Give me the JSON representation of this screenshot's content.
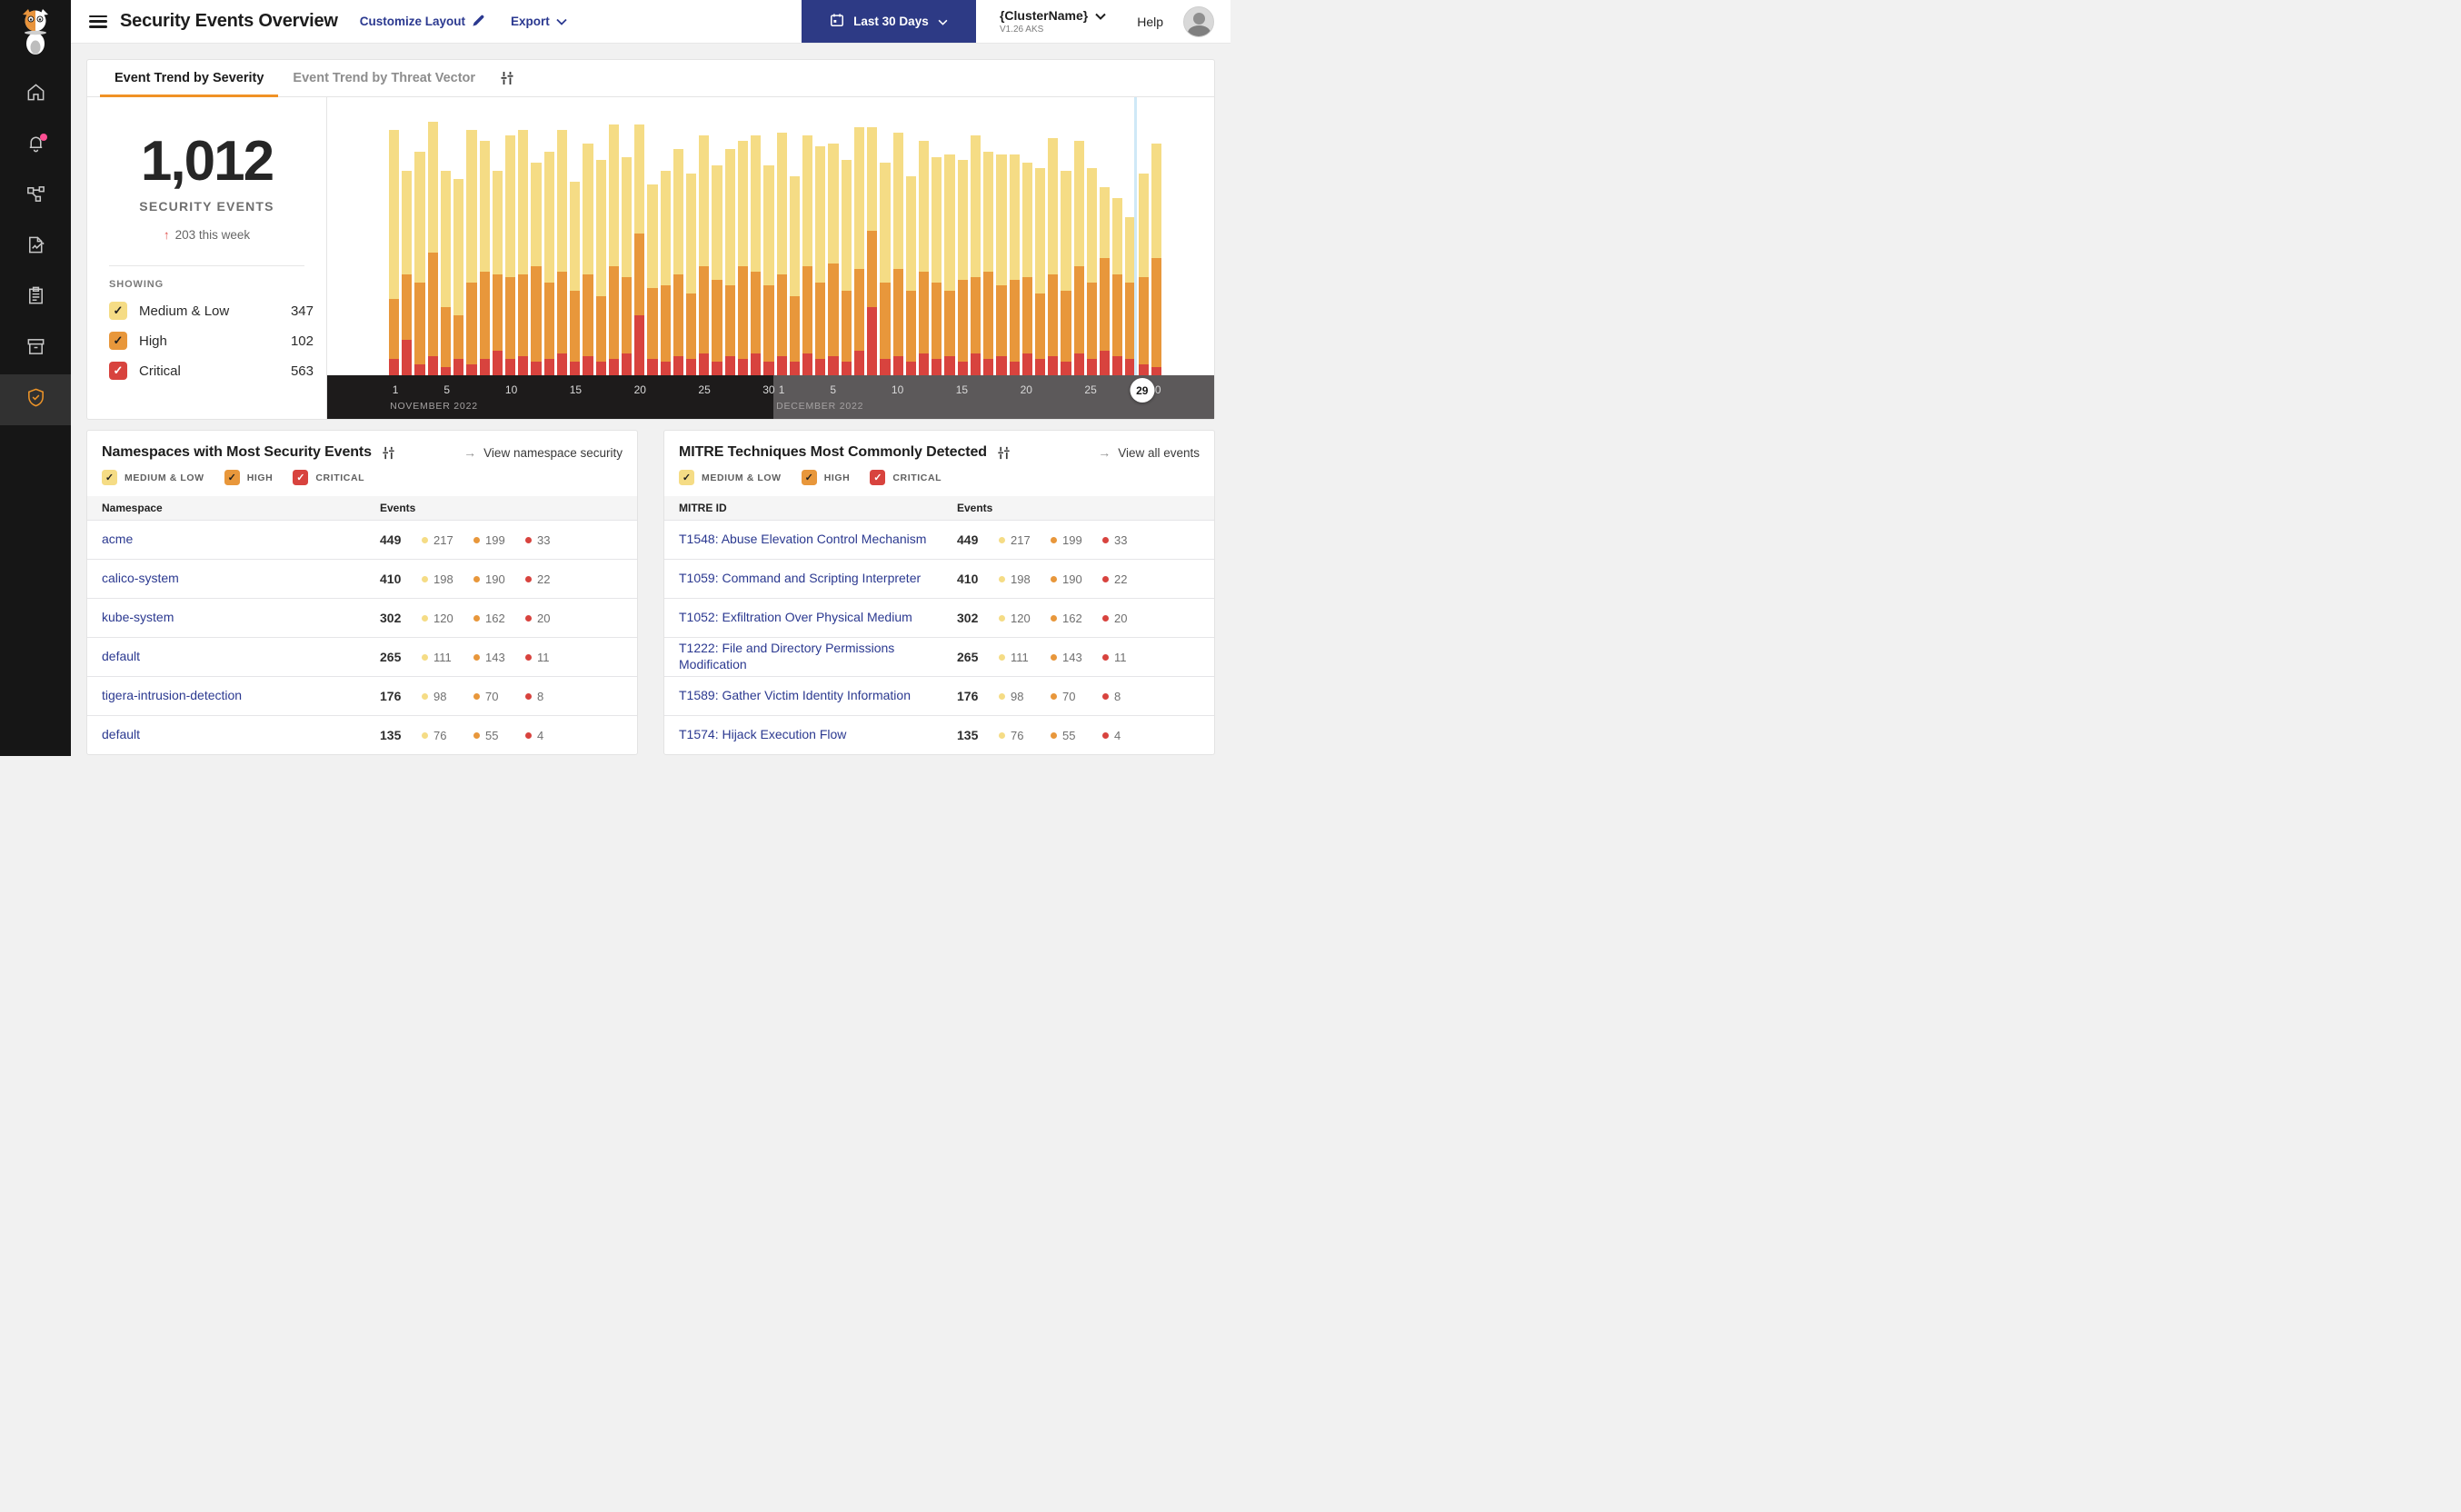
{
  "header": {
    "title": "Security Events Overview",
    "customize_layout": "Customize Layout",
    "export_label": "Export",
    "date_range": "Last 30 Days",
    "cluster_name": "{ClusterName}",
    "cluster_version": "V1.26 AKS",
    "help": "Help"
  },
  "sidebar": {
    "items": [
      "home",
      "notifications",
      "service-graph",
      "policies",
      "compliance-reports",
      "workloads",
      "security-events"
    ],
    "active_item": "security-events",
    "notification_badge": true
  },
  "tabs": {
    "severity": "Event Trend by Severity",
    "threat_vector": "Event Trend by Threat Vector"
  },
  "summary": {
    "total": "1,012",
    "label": "SECURITY EVENTS",
    "delta_arrow": "↑",
    "delta": "203 this week",
    "showing_label": "SHOWING",
    "severities": [
      {
        "label": "Medium & Low",
        "count": "347"
      },
      {
        "label": "High",
        "count": "102"
      },
      {
        "label": "Critical",
        "count": "563"
      }
    ]
  },
  "colors": {
    "medium": "#F5DC85",
    "high": "#E8973B",
    "critical": "#D8433E",
    "check_dark": "#1f1f1f",
    "check_light": "#ffffff",
    "accent": "#F09225",
    "navy": "#2B3990",
    "highlight_line": "#CFE9F7"
  },
  "chart_data": {
    "type": "bar",
    "stacked": true,
    "title": "Event Trend by Severity",
    "grid": false,
    "note": "no y-axis shown; values are estimated bar-segment heights as percent of plot height",
    "ylim": [
      0,
      100
    ],
    "months": [
      {
        "label": "NOVEMBER 2022",
        "days": 30,
        "ticks": [
          1,
          5,
          10,
          15,
          20,
          25,
          30
        ]
      },
      {
        "label": "DECEMBER 2022",
        "days": 30,
        "ticks": [
          1,
          5,
          10,
          15,
          20,
          25,
          30
        ]
      }
    ],
    "highlighted_day": {
      "month_index": 1,
      "day": 29,
      "marker": "29"
    },
    "series": [
      {
        "name": "Medium & Low",
        "values": [
          62,
          38,
          48,
          48,
          50,
          50,
          56,
          48,
          38,
          52,
          53,
          38,
          48,
          52,
          40,
          48,
          50,
          52,
          44,
          40,
          38,
          42,
          46,
          44,
          48,
          42,
          50,
          46,
          50,
          44,
          52,
          44,
          48,
          50,
          44,
          48,
          52,
          38,
          44,
          50,
          42,
          48,
          46,
          50,
          44,
          52,
          44,
          48,
          46,
          42,
          46,
          50,
          44,
          46,
          42,
          26,
          28,
          24,
          38,
          42
        ]
      },
      {
        "name": "High",
        "values": [
          22,
          24,
          30,
          38,
          22,
          16,
          30,
          32,
          28,
          30,
          30,
          35,
          28,
          30,
          26,
          30,
          24,
          34,
          28,
          30,
          26,
          28,
          30,
          24,
          32,
          30,
          26,
          34,
          30,
          28,
          30,
          24,
          32,
          28,
          34,
          26,
          30,
          28,
          28,
          32,
          26,
          30,
          28,
          24,
          30,
          28,
          32,
          26,
          30,
          28,
          24,
          30,
          26,
          32,
          28,
          34,
          30,
          28,
          32,
          40
        ]
      },
      {
        "name": "Critical",
        "values": [
          6,
          13,
          4,
          7,
          3,
          6,
          4,
          6,
          9,
          6,
          7,
          5,
          6,
          8,
          5,
          7,
          5,
          6,
          8,
          22,
          6,
          5,
          7,
          6,
          8,
          5,
          7,
          6,
          8,
          5,
          7,
          5,
          8,
          6,
          7,
          5,
          9,
          25,
          6,
          7,
          5,
          8,
          6,
          7,
          5,
          8,
          6,
          7,
          5,
          8,
          6,
          7,
          5,
          8,
          6,
          9,
          7,
          6,
          4,
          3
        ]
      }
    ]
  },
  "filters": [
    "MEDIUM & LOW",
    "HIGH",
    "CRITICAL"
  ],
  "namespaces_card": {
    "title": "Namespaces with Most Security Events",
    "link": "View namespace security",
    "columns": [
      "Namespace",
      "Events"
    ],
    "rows": [
      {
        "name": "acme",
        "total": 449,
        "medium": 217,
        "high": 199,
        "critical": 33
      },
      {
        "name": "calico-system",
        "total": 410,
        "medium": 198,
        "high": 190,
        "critical": 22
      },
      {
        "name": "kube-system",
        "total": 302,
        "medium": 120,
        "high": 162,
        "critical": 20
      },
      {
        "name": "default",
        "total": 265,
        "medium": 111,
        "high": 143,
        "critical": 11
      },
      {
        "name": "tigera-intrusion-detection",
        "total": 176,
        "medium": 98,
        "high": 70,
        "critical": 8
      },
      {
        "name": "default",
        "total": 135,
        "medium": 76,
        "high": 55,
        "critical": 4
      }
    ]
  },
  "mitre_card": {
    "title": "MITRE Techniques Most Commonly Detected",
    "link": "View all events",
    "columns": [
      "MITRE ID",
      "Events"
    ],
    "rows": [
      {
        "name": "T1548: Abuse Elevation Control Mechanism",
        "total": 449,
        "medium": 217,
        "high": 199,
        "critical": 33
      },
      {
        "name": "T1059: Command and Scripting Interpreter",
        "total": 410,
        "medium": 198,
        "high": 190,
        "critical": 22
      },
      {
        "name": "T1052: Exfiltration Over Physical Medium",
        "total": 302,
        "medium": 120,
        "high": 162,
        "critical": 20
      },
      {
        "name": "T1222: File and Directory Permissions Modification",
        "total": 265,
        "medium": 111,
        "high": 143,
        "critical": 11
      },
      {
        "name": "T1589: Gather Victim Identity Information",
        "total": 176,
        "medium": 98,
        "high": 70,
        "critical": 8
      },
      {
        "name": "T1574: Hijack Execution Flow",
        "total": 135,
        "medium": 76,
        "high": 55,
        "critical": 4
      }
    ]
  }
}
